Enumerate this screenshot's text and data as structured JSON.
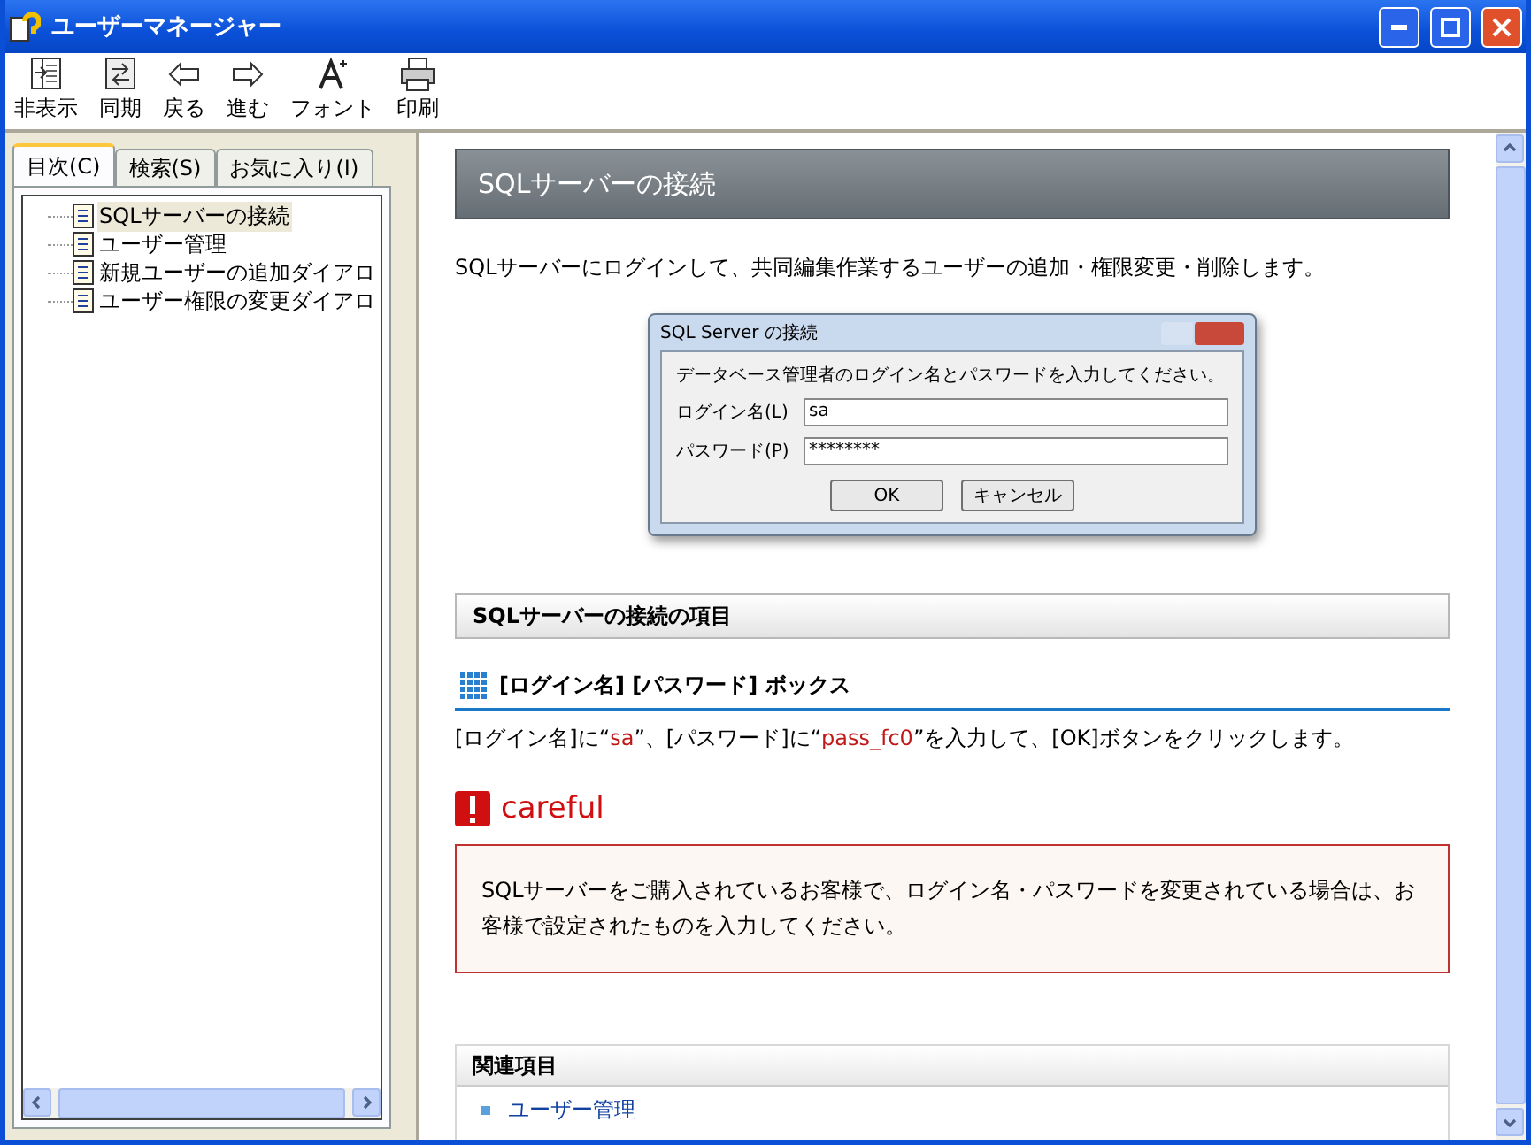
{
  "window": {
    "title": "ユーザーマネージャー"
  },
  "toolbar": [
    {
      "label": "非表示",
      "kind": "hide"
    },
    {
      "label": "同期",
      "kind": "sync"
    },
    {
      "label": "戻る",
      "kind": "back"
    },
    {
      "label": "進む",
      "kind": "forward"
    },
    {
      "label": "フォント",
      "kind": "font"
    },
    {
      "label": "印刷",
      "kind": "print"
    }
  ],
  "tabs": [
    {
      "label": "目次(C)",
      "selected": true
    },
    {
      "label": "検索(S)",
      "selected": false
    },
    {
      "label": "お気に入り(I)",
      "selected": false
    }
  ],
  "tree": [
    {
      "label": "SQLサーバーの接続",
      "selected": true
    },
    {
      "label": "ユーザー管理",
      "selected": false
    },
    {
      "label": "新規ユーザーの追加ダイアロ",
      "selected": false
    },
    {
      "label": "ユーザー権限の変更ダイアロ",
      "selected": false
    }
  ],
  "content": {
    "title": "SQLサーバーの接続",
    "intro": "SQLサーバーにログインして、共同編集作業するユーザーの追加・権限変更・削除します。",
    "dialog": {
      "title": "SQL Server の接続",
      "message": "データベース管理者のログイン名とパスワードを入力してください。",
      "fields": [
        {
          "label": "ログイン名(L)",
          "value": "sa"
        },
        {
          "label": "パスワード(P)",
          "value": "********"
        }
      ],
      "buttons": [
        "OK",
        "キャンセル"
      ]
    },
    "section_title": "SQLサーバーの接続の項目",
    "subheading": "[ログイン名] [パスワード] ボックス",
    "instruction": [
      {
        "text": "[ログイン名]に“",
        "kind": "plain"
      },
      {
        "text": "sa",
        "kind": "value"
      },
      {
        "text": "”、[パスワード]に“",
        "kind": "plain"
      },
      {
        "text": "pass_fc0",
        "kind": "value"
      },
      {
        "text": "”を入力して、[OK]ボタンをクリックします。",
        "kind": "plain"
      }
    ],
    "caution_label": "careful",
    "caution_text": "SQLサーバーをご購入されているお客様で、ログイン名・パスワードを変更されている場合は、お客様で設定されたものを入力してください。",
    "related_title": "関連項目",
    "related": [
      "ユーザー管理"
    ]
  }
}
